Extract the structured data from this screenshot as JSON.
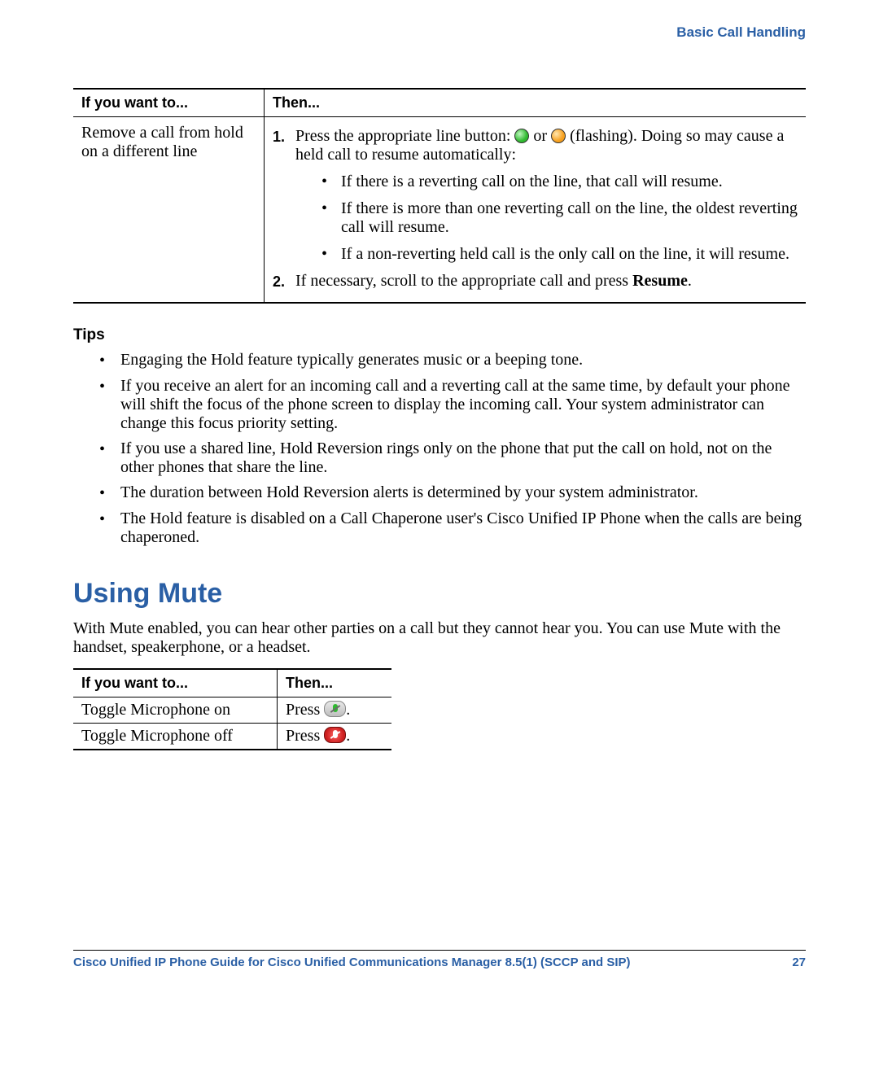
{
  "header": {
    "breadcrumb": "Basic Call Handling"
  },
  "table1": {
    "col1_header": "If you want to...",
    "col2_header": "Then...",
    "row1": {
      "want": "Remove a call from hold on a different line",
      "step1_num": "1.",
      "step1_pre": "Press the appropriate line button: ",
      "step1_mid": " or ",
      "step1_post": " (flashing). Doing so may cause a held call to resume automatically:",
      "sub1": "If there is a reverting call on the line, that call will resume.",
      "sub2": "If there is more than one reverting call on the line, the oldest reverting call will resume.",
      "sub3": "If a non-reverting held call is the only call on the line, it will resume.",
      "step2_num": "2.",
      "step2_pre": "If necessary, scroll to the appropriate call and press ",
      "step2_bold": "Resume",
      "step2_post": "."
    }
  },
  "tips": {
    "heading": "Tips",
    "items": [
      "Engaging the Hold feature typically generates music or a beeping tone.",
      "If you receive an alert for an incoming call and a reverting call at the same time, by default your phone will shift the focus of the phone screen to display the incoming call. Your system administrator can change this focus priority setting.",
      "If you use a shared line, Hold Reversion rings only on the phone that put the call on hold, not on the other phones that share the line.",
      "The duration between Hold Reversion alerts is determined by your system administrator.",
      "The Hold feature is disabled on a Call Chaperone user's Cisco Unified IP Phone when the calls are being chaperoned."
    ]
  },
  "mute": {
    "heading": "Using Mute",
    "intro": "With Mute enabled, you can hear other parties on a call but they cannot hear you. You can use Mute with the handset, speakerphone, or a headset.",
    "col1_header": "If you want to...",
    "col2_header": "Then...",
    "row1_want": "Toggle Microphone on",
    "row1_then_pre": "Press ",
    "row1_then_post": ".",
    "row2_want": "Toggle Microphone off",
    "row2_then_pre": "Press ",
    "row2_then_post": "."
  },
  "footer": {
    "title": "Cisco Unified IP Phone Guide for Cisco Unified Communications Manager 8.5(1) (SCCP and SIP)",
    "page": "27"
  }
}
